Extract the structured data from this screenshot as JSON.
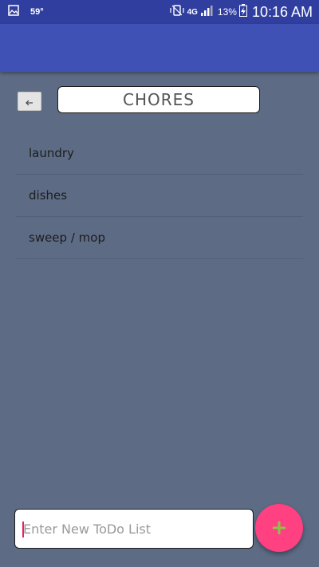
{
  "status_bar": {
    "temperature": "59°",
    "network": "4G",
    "battery": "13%",
    "time": "10:16 AM"
  },
  "header": {
    "back_icon": "arrow-left-icon",
    "title": "CHORES"
  },
  "list": {
    "items": [
      {
        "label": "laundry"
      },
      {
        "label": "dishes"
      },
      {
        "label": "sweep / mop"
      }
    ]
  },
  "new_list": {
    "placeholder": "Enter New ToDo List",
    "value": ""
  },
  "fab": {
    "icon": "plus-icon",
    "label": "+"
  },
  "colors": {
    "status_bar": "#303f9f",
    "app_bar": "#3f51b5",
    "background": "#5d6b85",
    "fab": "#ff4081",
    "fab_icon": "#8bc34a",
    "cursor": "#e91e63"
  }
}
